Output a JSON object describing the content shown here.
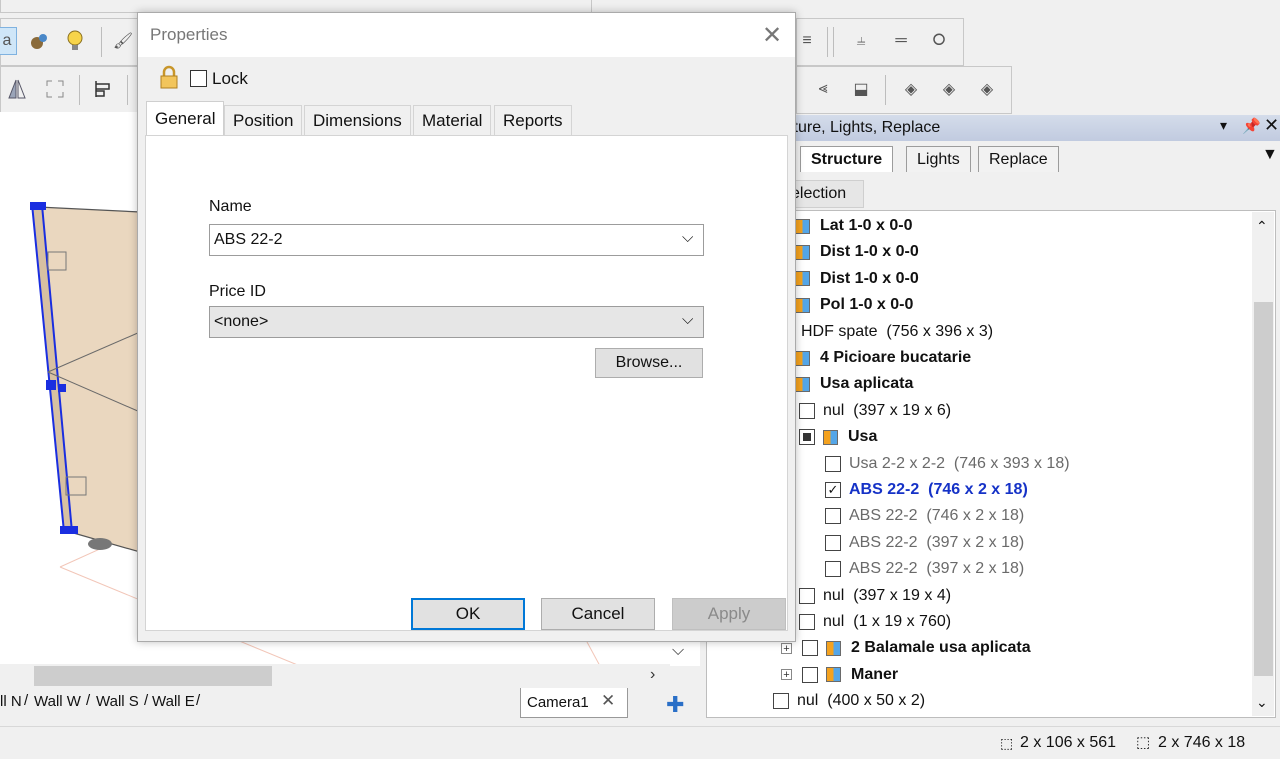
{
  "dialog": {
    "title": "Properties",
    "lock_label": "Lock",
    "tabs": [
      "General",
      "Position",
      "Dimensions",
      "Material",
      "Reports"
    ],
    "name_label": "Name",
    "name_value": "ABS 22-2",
    "price_label": "Price ID",
    "price_value": "<none>",
    "browse_label": "Browse...",
    "ok_label": "OK",
    "cancel_label": "Cancel",
    "apply_label": "Apply"
  },
  "panel": {
    "title": "icture, Lights, Replace",
    "tabs": [
      "Structure",
      "Lights",
      "Replace"
    ],
    "selection_label": "election"
  },
  "tree": [
    {
      "label": "Lat 1-0 x 0-0",
      "style": "b",
      "icon": true
    },
    {
      "label": "Dist 1-0 x 0-0",
      "style": "b",
      "icon": true
    },
    {
      "label": "Dist 1-0 x 0-0",
      "style": "b",
      "icon": true
    },
    {
      "label": "Pol 1-0 x 0-0",
      "style": "b",
      "icon": true
    },
    {
      "label": "HDF spate  (756 x 396 x 3)",
      "style": ""
    },
    {
      "label": "4 Picioare bucatarie",
      "style": "b",
      "icon": true
    },
    {
      "label": "Usa aplicata",
      "style": "b",
      "icon": true
    },
    {
      "label": "nul  (397 x 19 x 6)",
      "style": "",
      "check": "empty"
    },
    {
      "label": "Usa",
      "style": "b",
      "check": "filled",
      "icon": true
    },
    {
      "label": "Usa 2-2 x 2-2  (746 x 393 x 18)",
      "style": "g",
      "check": "empty"
    },
    {
      "label": "ABS 22-2  (746 x 2 x 18)",
      "style": "blue",
      "check": "checked"
    },
    {
      "label": "ABS 22-2  (746 x 2 x 18)",
      "style": "g",
      "check": "empty"
    },
    {
      "label": "ABS 22-2  (397 x 2 x 18)",
      "style": "g",
      "check": "empty"
    },
    {
      "label": "ABS 22-2  (397 x 2 x 18)",
      "style": "g",
      "check": "empty"
    },
    {
      "label": "nul  (397 x 19 x 4)",
      "style": "",
      "check": "empty"
    },
    {
      "label": "nul  (1 x 19 x 760)",
      "style": "",
      "check": "empty"
    },
    {
      "label": "2 Balamale usa aplicata",
      "style": "b",
      "check": "empty",
      "icon": true,
      "plus": true
    },
    {
      "label": "Maner",
      "style": "b",
      "check": "empty",
      "icon": true,
      "plus": true
    },
    {
      "label": "nul  (400 x 50 x 2)",
      "style": "",
      "check": "empty"
    }
  ],
  "view_tabs": [
    "ll N",
    "Wall W",
    "Wall S",
    "Wall E"
  ],
  "camera_tab": "Camera1",
  "status": {
    "size1": "2 x 106 x 561",
    "size2": "2 x 746 x 18"
  },
  "toolbar": {
    "partial_label": "a"
  },
  "colors": {
    "accent": "#0078d7",
    "selected_text": "#1532c7"
  }
}
